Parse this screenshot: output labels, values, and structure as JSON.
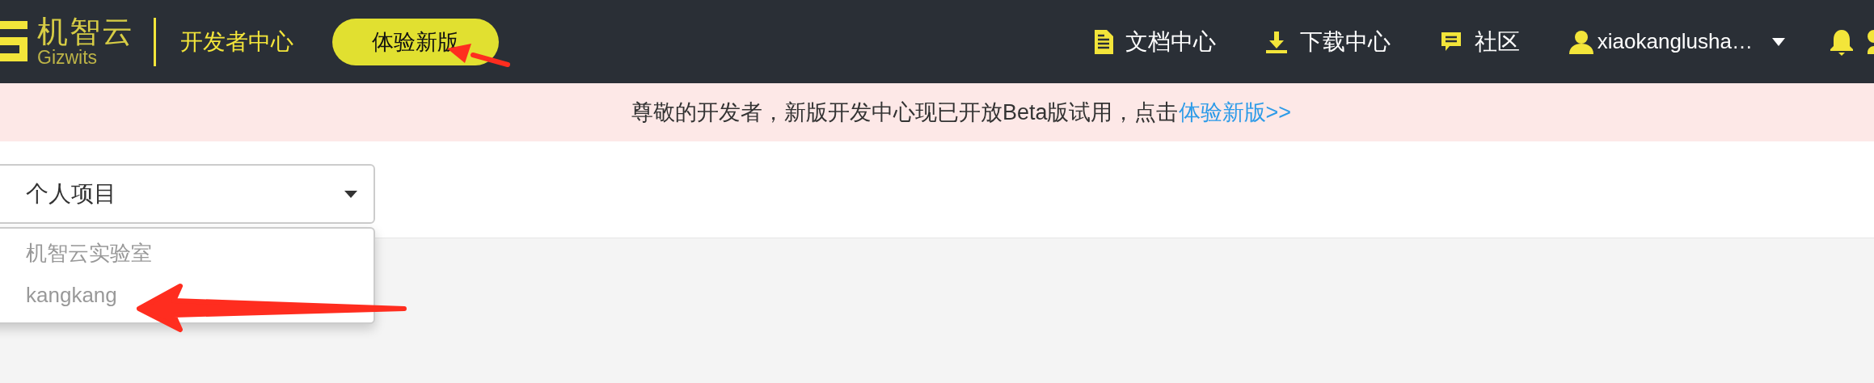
{
  "header": {
    "logo": {
      "name": "机智云",
      "subtitle": "Gizwits"
    },
    "section_title": "开发者中心",
    "try_button": "体验新版",
    "nav": [
      {
        "kind": "docs",
        "label": "文档中心"
      },
      {
        "kind": "download",
        "label": "下载中心"
      },
      {
        "kind": "community",
        "label": "社区"
      }
    ],
    "user": {
      "name": "xiaokanglusha…"
    }
  },
  "banner": {
    "text": "尊敬的开发者，新版开发中心现已开放Beta版试用，点击",
    "link": "体验新版>>"
  },
  "project_select": {
    "value": "个人项目",
    "options": [
      "机智云实验室",
      "kangkang"
    ]
  }
}
